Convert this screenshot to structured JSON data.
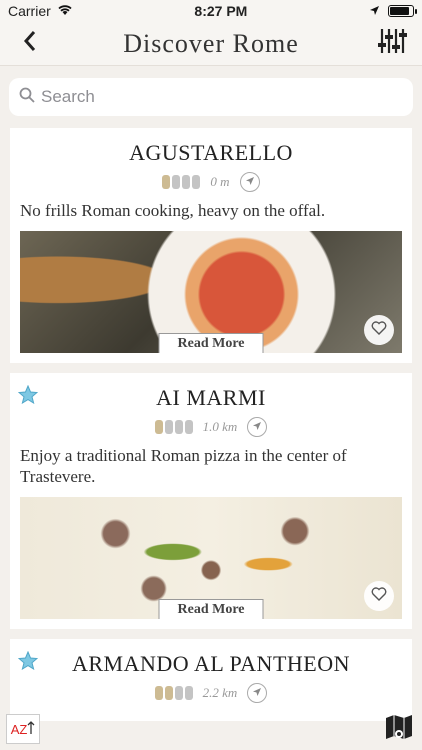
{
  "status": {
    "carrier": "Carrier",
    "time": "8:27 PM",
    "battery_level": 0.9
  },
  "nav": {
    "title": "Discover Rome"
  },
  "search": {
    "placeholder": "Search"
  },
  "restaurants": [
    {
      "name": "AGUSTARELLO",
      "price_level": 1,
      "price_max": 4,
      "distance": "0 m",
      "description": "No frills Roman cooking, heavy on the offal.",
      "read_more": "Read More",
      "starred": false
    },
    {
      "name": "AI MARMI",
      "price_level": 1,
      "price_max": 4,
      "distance": "1.0 km",
      "description": "Enjoy a traditional Roman pizza in the center of Trastevere.",
      "read_more": "Read More",
      "starred": true
    },
    {
      "name": "ARMANDO AL PANTHEON",
      "price_level": 2,
      "price_max": 4,
      "distance": "2.2 km",
      "description": "",
      "read_more": "",
      "starred": true
    }
  ],
  "bottom": {
    "sort_label": "AZ"
  },
  "colors": {
    "star": "#7ec8e3",
    "coin_on": "#cdbb93",
    "coin_off": "#c4c4c4"
  }
}
